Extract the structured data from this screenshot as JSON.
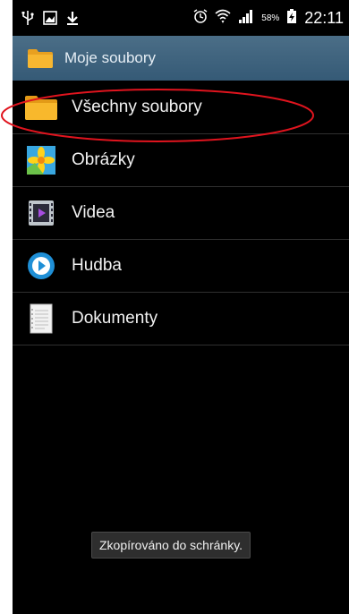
{
  "status_bar": {
    "battery_percent": "58%",
    "time": "22:11",
    "left_icons": [
      "usb-icon",
      "gallery-notification-icon",
      "download-icon"
    ],
    "right_icons": [
      "alarm-icon",
      "wifi-icon",
      "signal-icon",
      "battery-charging-icon"
    ]
  },
  "action_bar": {
    "title": "Moje soubory",
    "icon": "folder-icon"
  },
  "list": {
    "items": [
      {
        "label": "Všechny soubory",
        "icon": "folder-icon"
      },
      {
        "label": "Obrázky",
        "icon": "images-icon"
      },
      {
        "label": "Videa",
        "icon": "video-icon"
      },
      {
        "label": "Hudba",
        "icon": "music-icon"
      },
      {
        "label": "Dokumenty",
        "icon": "document-icon"
      }
    ]
  },
  "toast": {
    "text": "Zkopírováno do schránky."
  },
  "colors": {
    "background": "#000000",
    "action_bar": "#3f6480",
    "annotation_ellipse": "#e0141e"
  }
}
